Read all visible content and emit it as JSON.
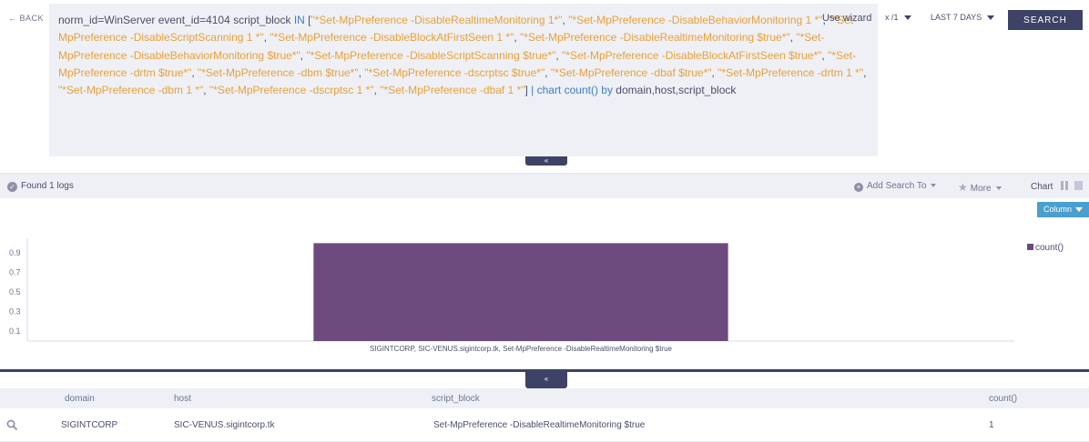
{
  "query_bar": {
    "back_label": "BACK",
    "query_segments": [
      {
        "t": "norm_id=WinServer event_id=4104 script_block ",
        "c": "plain"
      },
      {
        "t": "IN",
        "c": "kw"
      },
      {
        "t": " [",
        "c": "plain"
      },
      {
        "t": "\"*Set-MpPreference -DisableRealtimeMonitoring 1*\"",
        "c": "str"
      },
      {
        "t": ", ",
        "c": "plain"
      },
      {
        "t": "\"*Set-MpPreference -DisableBehaviorMonitoring 1 *\"",
        "c": "str"
      },
      {
        "t": ", ",
        "c": "plain"
      },
      {
        "t": "\"*Set-MpPreference -DisableScriptScanning 1 *\"",
        "c": "str"
      },
      {
        "t": ", ",
        "c": "plain"
      },
      {
        "t": "\"*Set-MpPreference -DisableBlockAtFirstSeen 1 *\"",
        "c": "str"
      },
      {
        "t": ", ",
        "c": "plain"
      },
      {
        "t": "\"*Set-MpPreference -DisableRealtimeMonitoring $true*\"",
        "c": "str"
      },
      {
        "t": ", ",
        "c": "plain"
      },
      {
        "t": "\"*Set-MpPreference -DisableBehaviorMonitoring $true*\"",
        "c": "str"
      },
      {
        "t": ", ",
        "c": "plain"
      },
      {
        "t": "\"*Set-MpPreference -DisableScriptScanning $true*\"",
        "c": "str"
      },
      {
        "t": ", ",
        "c": "plain"
      },
      {
        "t": "\"*Set-MpPreference -DisableBlockAtFirstSeen $true*\"",
        "c": "str"
      },
      {
        "t": ", ",
        "c": "plain"
      },
      {
        "t": "\"*Set-MpPreference -drtm $true*\"",
        "c": "str"
      },
      {
        "t": ", ",
        "c": "plain"
      },
      {
        "t": "\"*Set-MpPreference -dbm $true*\"",
        "c": "str"
      },
      {
        "t": ", ",
        "c": "plain"
      },
      {
        "t": "\"*Set-MpPreference -dscrptsc $true*\"",
        "c": "str"
      },
      {
        "t": ", ",
        "c": "plain"
      },
      {
        "t": "\"*Set-MpPreference -dbaf $true*\"",
        "c": "str"
      },
      {
        "t": ", ",
        "c": "plain"
      },
      {
        "t": "\"*Set-MpPreference -drtm 1 *\"",
        "c": "str"
      },
      {
        "t": ", ",
        "c": "plain"
      },
      {
        "t": "\"*Set-MpPreference -dbm 1 *\"",
        "c": "str"
      },
      {
        "t": ", ",
        "c": "plain"
      },
      {
        "t": "\"*Set-MpPreference -dscrptsc 1 *\"",
        "c": "str"
      },
      {
        "t": ", ",
        "c": "plain"
      },
      {
        "t": "\"*Set-MpPreference -dbaf 1 *\"",
        "c": "str"
      },
      {
        "t": "] ",
        "c": "plain"
      },
      {
        "t": "| chart count() by",
        "c": "pipe"
      },
      {
        "t": " domain,host,script_block",
        "c": "plain"
      }
    ],
    "use_wizard_label": "Use wizard",
    "repo_label": "x /1",
    "time_range_label": "LAST 7 DAYS",
    "search_label": "SEARCH",
    "collapse_glyph": "«"
  },
  "found_bar": {
    "found_text": "Found 1 logs",
    "add_search_label": "Add Search To",
    "more_label": "More",
    "chart_label": "Chart"
  },
  "chart": {
    "column_label": "Column",
    "legend_label": "count()",
    "bar_color": "#6d4a7e"
  },
  "chart_data": {
    "type": "bar",
    "categories": [
      "SIGINTCORP, SIC-VENUS.sigintcorp.tk, Set-MpPreference -DisableRealtimeMonitoring $true"
    ],
    "series": [
      {
        "name": "count()",
        "values": [
          1
        ]
      }
    ],
    "yticks": [
      "0.9",
      "0.7",
      "0.5",
      "0.3",
      "0.1"
    ],
    "ytick_values": [
      0.9,
      0.7,
      0.5,
      0.3,
      0.1
    ],
    "ylim": [
      0,
      1.05
    ],
    "title": "",
    "xlabel": "",
    "ylabel": "",
    "legend": "right"
  },
  "results": {
    "collapse_glyph": "«",
    "columns": [
      "domain",
      "host",
      "script_block",
      "count()"
    ],
    "rows": [
      {
        "domain": "SIGINTCORP",
        "host": "SIC-VENUS.sigintcorp.tk",
        "script_block": "Set-MpPreference -DisableRealtimeMonitoring $true",
        "count": "1"
      }
    ]
  },
  "colors": {
    "accent": "#3d4266",
    "keyword": "#3b7fc4",
    "string": "#e8a13a",
    "column_button": "#4a9fd0"
  }
}
